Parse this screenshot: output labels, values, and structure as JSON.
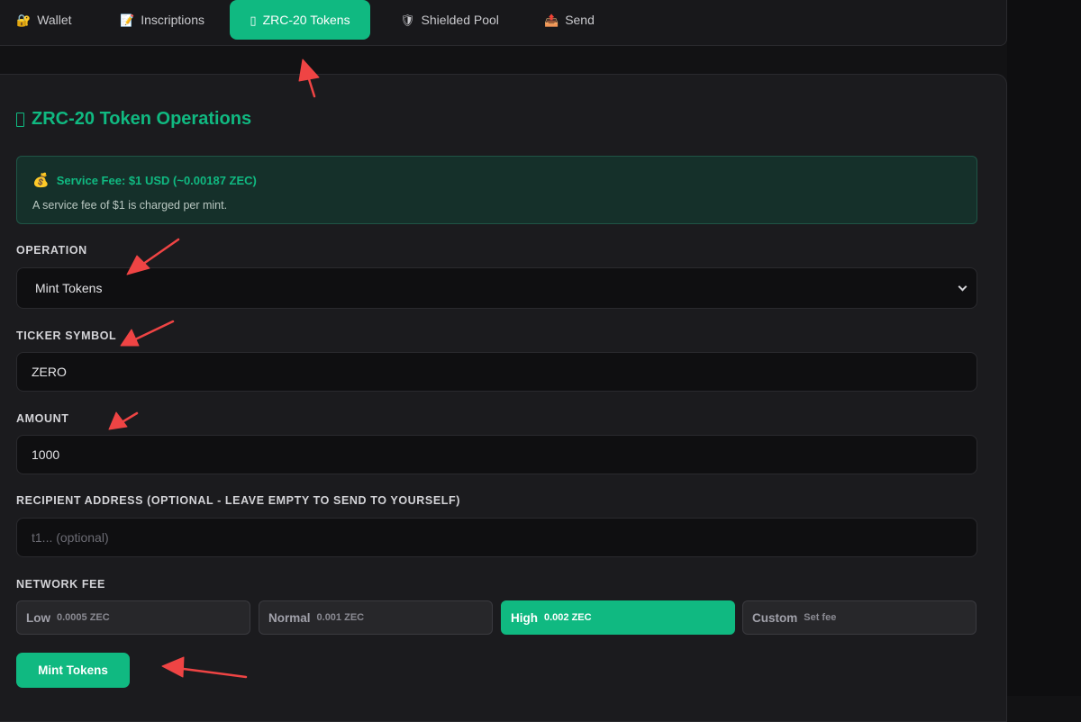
{
  "nav": {
    "tabs": [
      {
        "label": "Wallet",
        "icon": "lock-icon",
        "glyph": "🔐"
      },
      {
        "label": "Inscriptions",
        "icon": "memo-icon",
        "glyph": "📝"
      },
      {
        "label": "ZRC-20 Tokens",
        "icon": "coin-icon",
        "glyph": "▯",
        "active": true
      },
      {
        "label": "Shielded Pool",
        "icon": "shield-icon",
        "glyph": "🛡"
      },
      {
        "label": "Send",
        "icon": "outbox-icon",
        "glyph": "📤"
      }
    ]
  },
  "panel": {
    "title": "ZRC-20 Token Operations",
    "service_fee": {
      "icon": "money-bag-icon",
      "heading": "Service Fee: $1 USD (~0.00187 ZEC)",
      "description": "A service fee of $1 is charged per mint."
    },
    "operation": {
      "label": "OPERATION",
      "value": "Mint Tokens"
    },
    "ticker": {
      "label": "TICKER SYMBOL",
      "value": "ZERO"
    },
    "amount": {
      "label": "AMOUNT",
      "value": "1000"
    },
    "recipient": {
      "label": "RECIPIENT ADDRESS (OPTIONAL - LEAVE EMPTY TO SEND TO YOURSELF)",
      "placeholder": "t1... (optional)"
    },
    "network_fee": {
      "label": "NETWORK FEE",
      "options": [
        {
          "name": "Low",
          "value": "0.0005 ZEC"
        },
        {
          "name": "Normal",
          "value": "0.001 ZEC"
        },
        {
          "name": "High",
          "value": "0.002 ZEC",
          "selected": true
        },
        {
          "name": "Custom",
          "value": "Set fee"
        }
      ]
    },
    "submit_label": "Mint Tokens"
  },
  "colors": {
    "accent": "#10b981",
    "background": "#121214",
    "panel": "#1b1b1e",
    "annotation_arrow": "#ef4444"
  }
}
